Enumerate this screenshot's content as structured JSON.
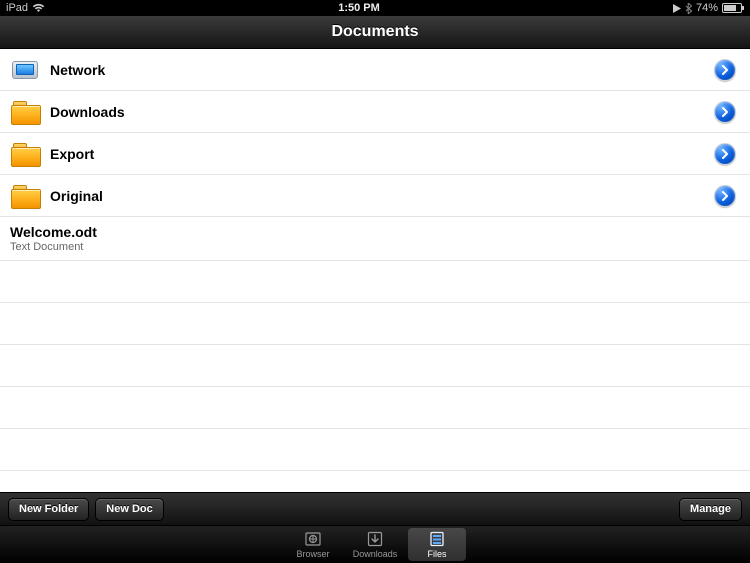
{
  "status": {
    "carrier": "iPad",
    "time": "1:50 PM",
    "battery": "74%"
  },
  "title": "Documents",
  "items": [
    {
      "icon": "network",
      "label": "Network"
    },
    {
      "icon": "folder",
      "label": "Downloads"
    },
    {
      "icon": "folder",
      "label": "Export"
    },
    {
      "icon": "folder",
      "label": "Original"
    }
  ],
  "file": {
    "name": "Welcome.odt",
    "subtitle": "Text Document"
  },
  "toolbar": {
    "new_folder": "New Folder",
    "new_doc": "New Doc",
    "manage": "Manage"
  },
  "tabs": {
    "browser": "Browser",
    "downloads": "Downloads",
    "files": "Files"
  }
}
